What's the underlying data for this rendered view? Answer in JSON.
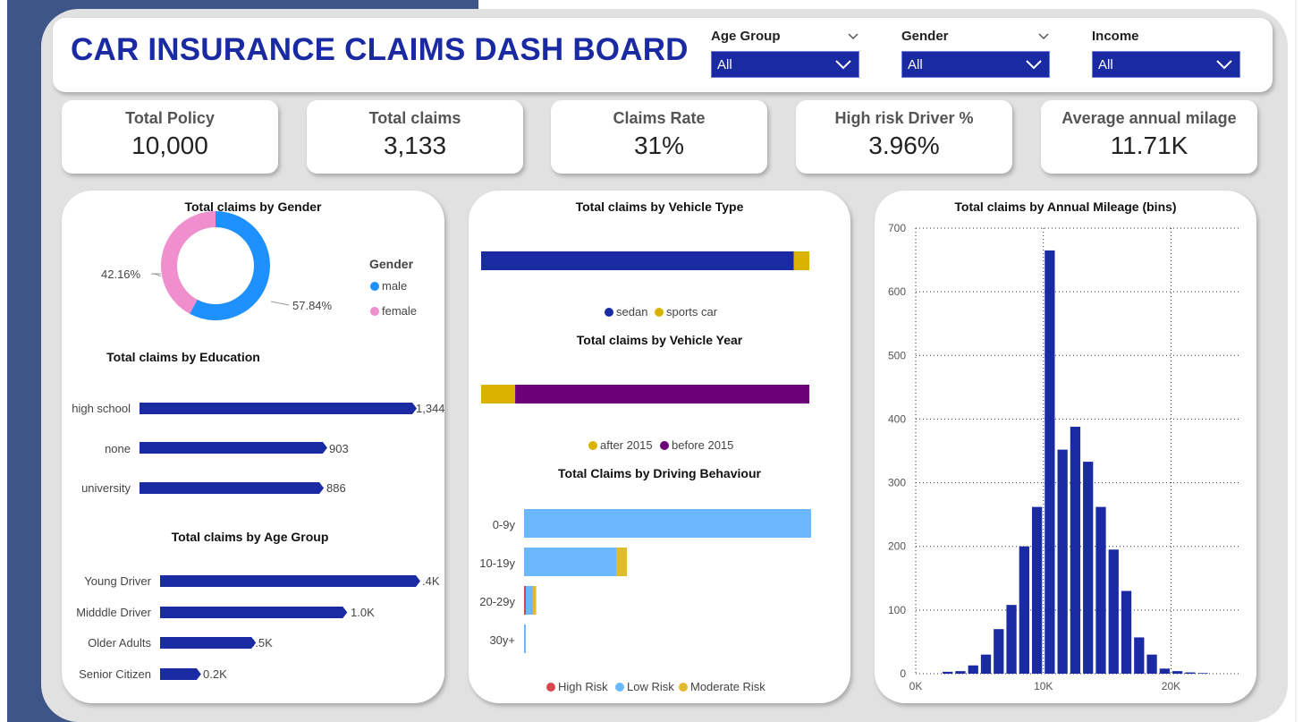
{
  "header": {
    "title": "CAR INSURANCE CLAIMS DASH BOARD",
    "filters": [
      {
        "label": "Age Group",
        "value": "All"
      },
      {
        "label": "Gender",
        "value": "All"
      },
      {
        "label": "Income",
        "value": "All"
      }
    ]
  },
  "kpis": [
    {
      "label": "Total Policy",
      "value": "10,000"
    },
    {
      "label": "Total claims",
      "value": "3,133"
    },
    {
      "label": "Claims Rate",
      "value": "31%"
    },
    {
      "label": "High risk Driver %",
      "value": "3.96%"
    },
    {
      "label": "Average annual milage",
      "value": "11.71K"
    }
  ],
  "colors": {
    "navy": "#1a2aa3",
    "male": "#1e90ff",
    "female": "#ef8fcd",
    "sedan": "#1a2aa3",
    "sports_car": "#dab300",
    "after_2015": "#dab300",
    "before_2015": "#6b0079",
    "high_risk": "#d64550",
    "low_risk": "#6cb8ff",
    "moderate_risk": "#e0bb2e"
  },
  "chart_data": [
    {
      "type": "pie",
      "title": "Total claims by Gender",
      "legend_title": "Gender",
      "legend_position": "right",
      "categories": [
        "male",
        "female"
      ],
      "values": [
        57.84,
        42.16
      ],
      "labels": [
        "57.84%",
        "42.16%"
      ]
    },
    {
      "type": "bar",
      "orientation": "horizontal",
      "title": "Total claims by Education",
      "categories": [
        "high school",
        "none",
        "university"
      ],
      "values": [
        1344,
        903,
        886
      ],
      "labels": [
        "1,344",
        "903",
        "886"
      ]
    },
    {
      "type": "bar",
      "orientation": "horizontal",
      "title": "Total claims by Age Group",
      "categories": [
        "Young Driver",
        "Midddle Driver",
        "Older Adults",
        "Senior Citizen"
      ],
      "values": [
        1400,
        1000,
        500,
        200
      ],
      "labels": [
        ".4K",
        "1.0K",
        "0.5K",
        "0.2K"
      ]
    },
    {
      "type": "bar",
      "orientation": "horizontal",
      "stacked": true,
      "title": "Total claims by Vehicle Type",
      "legend_position": "bottom",
      "series": [
        {
          "name": "sedan",
          "values": [
            2985
          ]
        },
        {
          "name": "sports car",
          "values": [
            148
          ]
        }
      ]
    },
    {
      "type": "bar",
      "orientation": "horizontal",
      "stacked": true,
      "title": "Total claims by Vehicle Year",
      "legend_position": "bottom",
      "series": [
        {
          "name": "after 2015",
          "values": [
            325
          ]
        },
        {
          "name": "before 2015",
          "values": [
            2808
          ]
        }
      ]
    },
    {
      "type": "bar",
      "orientation": "horizontal",
      "stacked": true,
      "title": "Total Claims by Driving Behaviour",
      "legend_position": "bottom",
      "categories": [
        "0-9y",
        "10-19y",
        "20-29y",
        "30y+"
      ],
      "series": [
        {
          "name": "High Risk",
          "values": [
            0,
            0,
            5,
            0
          ]
        },
        {
          "name": "Low Risk",
          "values": [
            1800,
            580,
            45,
            10
          ]
        },
        {
          "name": "Moderate  Risk",
          "values": [
            0,
            65,
            20,
            0
          ]
        }
      ]
    },
    {
      "type": "bar",
      "title": "Total claims by Annual Mileage (bins)",
      "xlim": [
        0,
        25500
      ],
      "ylim": [
        0,
        700
      ],
      "x_ticks": [
        "0K",
        "10K",
        "20K"
      ],
      "y_ticks": [
        "0",
        "100",
        "200",
        "300",
        "400",
        "500",
        "600",
        "700"
      ],
      "grid": true,
      "x": [
        2500,
        3500,
        4500,
        5500,
        6500,
        7500,
        8500,
        9500,
        10500,
        11500,
        12500,
        13500,
        14500,
        15500,
        16500,
        17500,
        18500,
        19500,
        20500,
        21500,
        22500
      ],
      "values": [
        3,
        4,
        13,
        30,
        70,
        108,
        200,
        262,
        665,
        352,
        388,
        333,
        262,
        195,
        130,
        57,
        30,
        8,
        4,
        2,
        1
      ]
    }
  ]
}
